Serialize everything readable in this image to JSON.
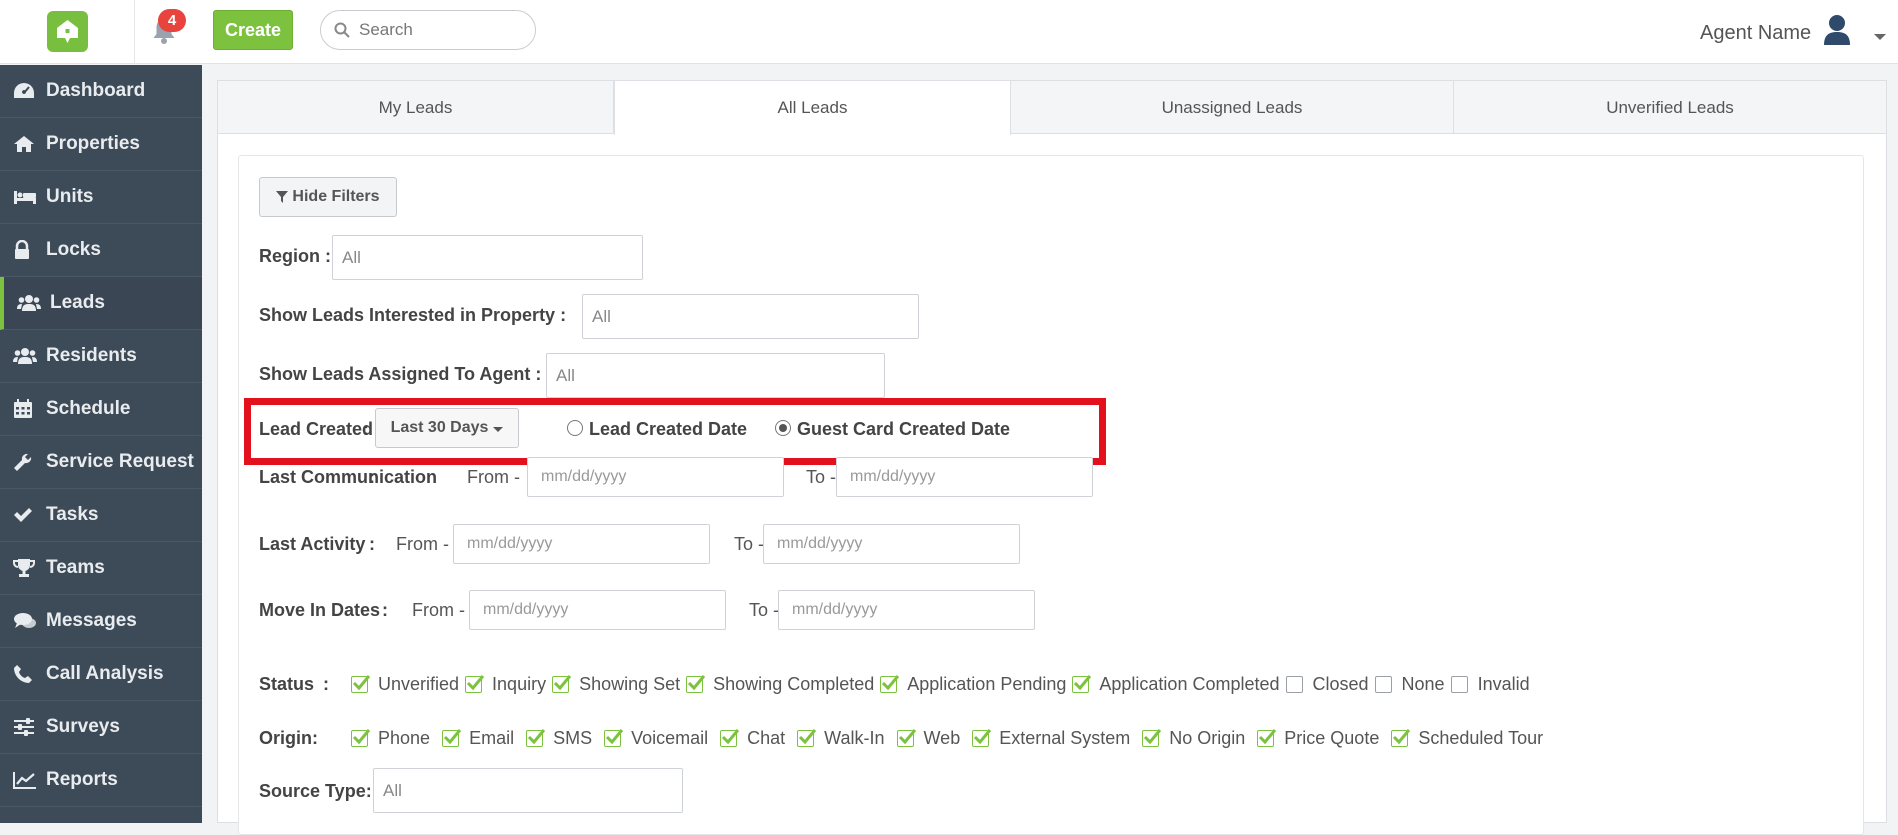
{
  "topbar": {
    "notification_count": "4",
    "create_label": "Create",
    "search_placeholder": "Search",
    "agent_name": "Agent Name"
  },
  "sidebar": {
    "items": [
      {
        "label": "Dashboard",
        "icon": "dashboard-icon"
      },
      {
        "label": "Properties",
        "icon": "home-icon"
      },
      {
        "label": "Units",
        "icon": "bed-icon"
      },
      {
        "label": "Locks",
        "icon": "lock-icon"
      },
      {
        "label": "Leads",
        "icon": "users-icon",
        "active": true
      },
      {
        "label": "Residents",
        "icon": "users-icon"
      },
      {
        "label": "Schedule",
        "icon": "calendar-icon"
      },
      {
        "label": "Service Request",
        "icon": "wrench-icon"
      },
      {
        "label": "Tasks",
        "icon": "check-icon"
      },
      {
        "label": "Teams",
        "icon": "trophy-icon"
      },
      {
        "label": "Messages",
        "icon": "chat-icon"
      },
      {
        "label": "Call Analysis",
        "icon": "phone-icon"
      },
      {
        "label": "Surveys",
        "icon": "sliders-icon"
      },
      {
        "label": "Reports",
        "icon": "line-chart-icon"
      }
    ]
  },
  "tabs": [
    {
      "label": "My Leads",
      "active": false
    },
    {
      "label": "All Leads",
      "active": true
    },
    {
      "label": "Unassigned Leads",
      "active": false
    },
    {
      "label": "Unverified Leads",
      "active": false
    }
  ],
  "filters": {
    "hide_filters_label": "Hide Filters",
    "region_label": "Region :",
    "region_value": "All",
    "property_label": "Show Leads Interested in Property :",
    "property_value": "All",
    "agent_label": "Show Leads Assigned To Agent :",
    "agent_value": "All",
    "lead_created_label": "Lead Created",
    "colon": ":",
    "lead_created_range": "Last 30 Days",
    "radio_lead_created_date": "Lead Created Date",
    "radio_guest_card_date": "Guest Card Created Date",
    "selected_radio": "Guest Card Created Date",
    "last_communication_label": "Last Communication",
    "last_activity_label": "Last Activity",
    "move_in_label": "Move In Dates",
    "from_label": "From -",
    "to_label": "To -",
    "date_placeholder": "mm/dd/yyyy",
    "status_label": "Status",
    "status_options": [
      {
        "label": "Unverified",
        "checked": true
      },
      {
        "label": "Inquiry",
        "checked": true
      },
      {
        "label": "Showing Set",
        "checked": true
      },
      {
        "label": "Showing Completed",
        "checked": true
      },
      {
        "label": "Application Pending",
        "checked": true
      },
      {
        "label": "Application Completed",
        "checked": true
      },
      {
        "label": "Closed",
        "checked": false
      },
      {
        "label": "None",
        "checked": false
      },
      {
        "label": "Invalid",
        "checked": false
      }
    ],
    "origin_label": "Origin:",
    "origin_options": [
      {
        "label": "Phone",
        "checked": true
      },
      {
        "label": "Email",
        "checked": true
      },
      {
        "label": "SMS",
        "checked": true
      },
      {
        "label": "Voicemail",
        "checked": true
      },
      {
        "label": "Chat",
        "checked": true
      },
      {
        "label": "Walk-In",
        "checked": true
      },
      {
        "label": "Web",
        "checked": true
      },
      {
        "label": "External System",
        "checked": true
      },
      {
        "label": "No Origin",
        "checked": true
      },
      {
        "label": "Price Quote",
        "checked": true
      },
      {
        "label": "Scheduled Tour",
        "checked": true
      }
    ],
    "source_type_label": "Source Type:",
    "source_type_value": "All"
  },
  "colors": {
    "brand_green": "#7cc23f",
    "sidebar_bg": "#3d4a57",
    "badge_red": "#e8443d",
    "highlight_red": "#e3111e"
  }
}
